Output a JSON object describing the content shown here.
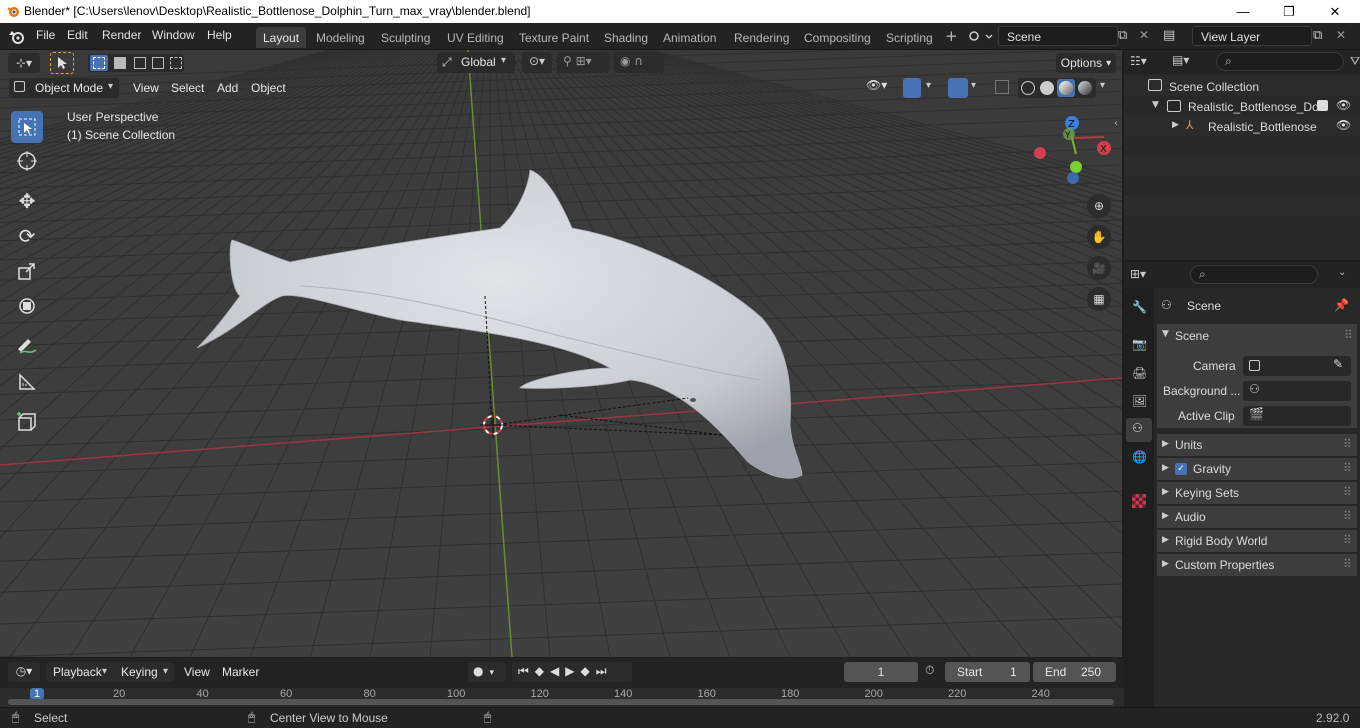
{
  "window": {
    "title": "Blender* [C:\\Users\\lenov\\Desktop\\Realistic_Bottlenose_Dolphin_Turn_max_vray\\blender.blend]",
    "minimize": "—",
    "maximize": "❐",
    "close": "✕"
  },
  "menu": [
    "File",
    "Edit",
    "Render",
    "Window",
    "Help"
  ],
  "workspaces": [
    "Layout",
    "Modeling",
    "Sculpting",
    "UV Editing",
    "Texture Paint",
    "Shading",
    "Animation",
    "Rendering",
    "Compositing",
    "Scripting"
  ],
  "active_workspace": "Layout",
  "scene_field": "Scene",
  "view_layer_field": "View Layer",
  "viewport_header": {
    "transform_orientation": "Global",
    "options": "Options",
    "mode": "Object Mode",
    "menus": [
      "View",
      "Select",
      "Add",
      "Object"
    ]
  },
  "viewport": {
    "perspective": "User Perspective",
    "collection": "(1) Scene Collection",
    "gizmo": {
      "z": "Z",
      "y": "Y",
      "x": "X"
    }
  },
  "outliner": {
    "root": "Scene Collection",
    "items": [
      {
        "label": "Realistic_Bottlenose_Dol"
      },
      {
        "label": "Realistic_Bottlenose"
      }
    ]
  },
  "properties": {
    "context": "Scene",
    "panel_title": "Scene",
    "fields": [
      {
        "label": "Camera"
      },
      {
        "label": "Background ..."
      },
      {
        "label": "Active Clip"
      }
    ],
    "sections": [
      "Units",
      "Gravity",
      "Keying Sets",
      "Audio",
      "Rigid Body World",
      "Custom Properties"
    ]
  },
  "timeline": {
    "menus": [
      "Playback",
      "Keying",
      "View",
      "Marker"
    ],
    "current_frame": "1",
    "start_label": "Start",
    "start": "1",
    "end_label": "End",
    "end": "250",
    "ruler": [
      "1",
      "20",
      "40",
      "60",
      "80",
      "100",
      "120",
      "140",
      "160",
      "180",
      "200",
      "220",
      "240"
    ]
  },
  "status": {
    "select": "Select",
    "center": "Center View to Mouse",
    "version": "2.92.0"
  }
}
